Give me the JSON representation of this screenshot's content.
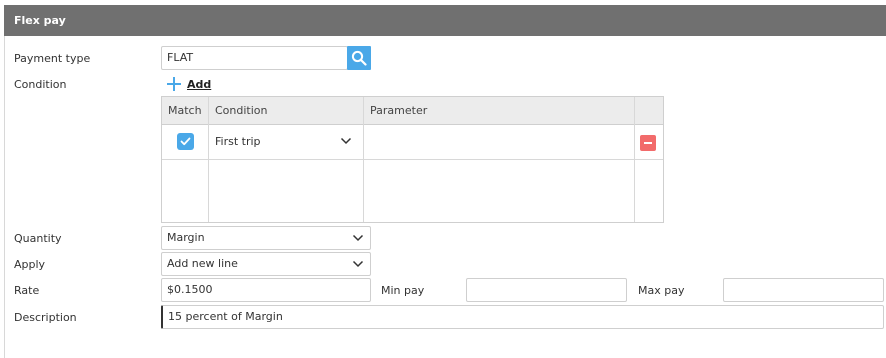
{
  "panel": {
    "title": "Flex pay"
  },
  "payment_type": {
    "label": "Payment type",
    "value": "FLAT"
  },
  "condition": {
    "label": "Condition",
    "add_label": "Add",
    "grid": {
      "columns": [
        "Match",
        "Condition",
        "Parameter"
      ],
      "rows": [
        {
          "match": true,
          "condition": "First trip",
          "parameter": ""
        }
      ]
    }
  },
  "quantity": {
    "label": "Quantity",
    "value": "Margin"
  },
  "apply": {
    "label": "Apply",
    "value": "Add new line"
  },
  "rate": {
    "label": "Rate",
    "value": "$0.1500"
  },
  "min_pay": {
    "label": "Min pay",
    "value": ""
  },
  "max_pay": {
    "label": "Max pay",
    "value": ""
  },
  "description": {
    "label": "Description",
    "value": "15 percent of Margin"
  },
  "colors": {
    "header": "#707070",
    "accent": "#4aa8e8",
    "danger": "#f26b6b"
  }
}
